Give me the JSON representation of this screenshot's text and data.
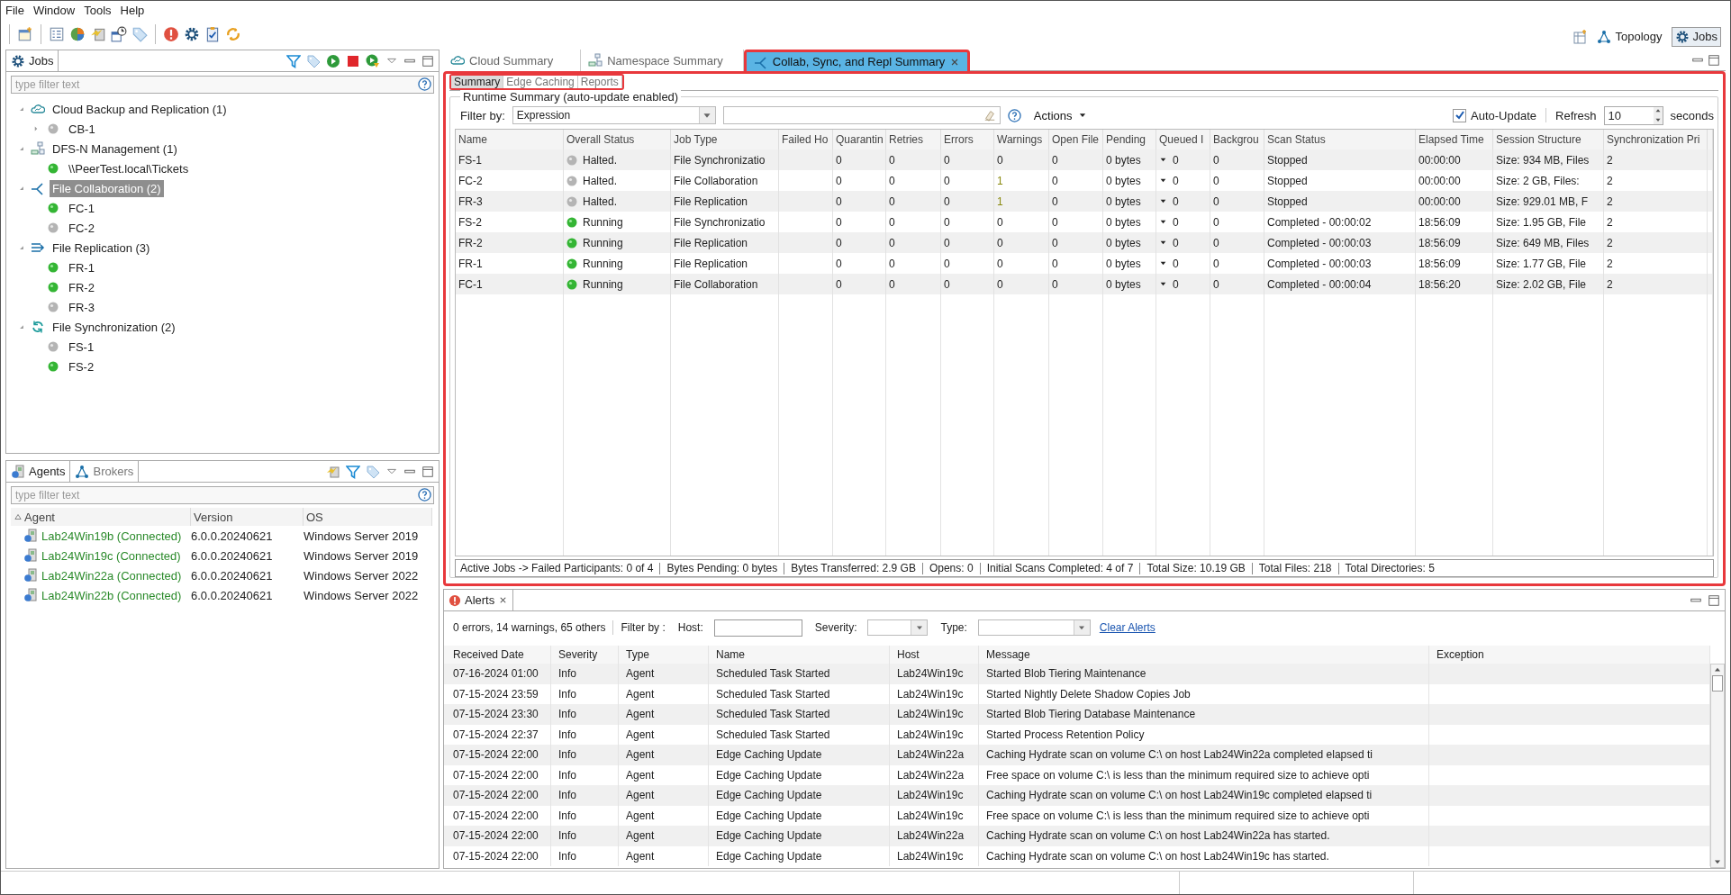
{
  "menu": [
    "File",
    "Window",
    "Tools",
    "Help"
  ],
  "perspectives": [
    {
      "label": "Topology",
      "selected": false
    },
    {
      "label": "Jobs",
      "selected": true
    }
  ],
  "jobs_panel": {
    "title": "Jobs",
    "filter_placeholder": "type filter text",
    "tree": [
      {
        "label": "Cloud Backup and Replication (1)",
        "kind": "cloud",
        "selected": false,
        "expanded": true,
        "children": [
          {
            "label": "CB-1",
            "running": false,
            "expandable": true
          }
        ]
      },
      {
        "label": "DFS-N Management (1)",
        "kind": "namespace",
        "selected": false,
        "expanded": true,
        "children": [
          {
            "label": "\\\\PeerTest.local\\Tickets",
            "running": true,
            "expandable": false
          }
        ]
      },
      {
        "label": "File Collaboration (2)",
        "kind": "collab",
        "selected": true,
        "expanded": true,
        "children": [
          {
            "label": "FC-1",
            "running": true,
            "expandable": false
          },
          {
            "label": "FC-2",
            "running": false,
            "expandable": false
          }
        ]
      },
      {
        "label": "File Replication (3)",
        "kind": "replication",
        "selected": false,
        "expanded": true,
        "children": [
          {
            "label": "FR-1",
            "running": true,
            "expandable": false
          },
          {
            "label": "FR-2",
            "running": true,
            "expandable": false
          },
          {
            "label": "FR-3",
            "running": false,
            "expandable": false
          }
        ]
      },
      {
        "label": "File Synchronization (2)",
        "kind": "sync",
        "selected": false,
        "expanded": true,
        "children": [
          {
            "label": "FS-1",
            "running": false,
            "expandable": false
          },
          {
            "label": "FS-2",
            "running": true,
            "expandable": false
          }
        ]
      }
    ]
  },
  "agents_panel": {
    "tabs": [
      {
        "label": "Agents",
        "kind": "agents",
        "selected": true
      },
      {
        "label": "Brokers",
        "kind": "brokers",
        "selected": false
      }
    ],
    "filter_placeholder": "type filter text",
    "columns": [
      "Agent",
      "Version",
      "OS"
    ],
    "rows": [
      {
        "agent": "Lab24Win19b (Connected)",
        "version": "6.0.0.20240621",
        "os": "Windows Server 2019",
        "connected": true
      },
      {
        "agent": "Lab24Win19c (Connected)",
        "version": "6.0.0.20240621",
        "os": "Windows Server 2019",
        "connected": true
      },
      {
        "agent": "Lab24Win22a (Connected)",
        "version": "6.0.0.20240621",
        "os": "Windows Server 2022",
        "connected": true
      },
      {
        "agent": "Lab24Win22b (Connected)",
        "version": "6.0.0.20240621",
        "os": "Windows Server 2022",
        "connected": true
      }
    ]
  },
  "editor_tabs": [
    {
      "label": "Cloud Summary",
      "kind": "cloud",
      "selected": false,
      "closable": false
    },
    {
      "label": "Namespace Summary",
      "kind": "namespace",
      "selected": false,
      "closable": false
    },
    {
      "label": "Collab, Sync, and Repl Summary",
      "kind": "collab",
      "selected": true,
      "closable": true
    }
  ],
  "sub_tabs": [
    {
      "label": "Summary",
      "selected": true
    },
    {
      "label": "Edge Caching",
      "selected": false
    },
    {
      "label": "Reports",
      "selected": false
    }
  ],
  "runtime": {
    "group_title": "Runtime Summary (auto-update enabled)",
    "filter_label": "Filter by:",
    "filter_value": "Expression",
    "actions": "Actions",
    "auto_update": {
      "label": "Auto-Update",
      "checked": true
    },
    "refresh_label": "Refresh",
    "refresh_value": "10",
    "refresh_unit": "seconds"
  },
  "jobs_table": {
    "columns": [
      {
        "label": "Name",
        "kind": "text"
      },
      {
        "label": "Overall Status",
        "kind": "status"
      },
      {
        "label": "Job Type",
        "kind": "text"
      },
      {
        "label": "Failed Ho",
        "kind": "text"
      },
      {
        "label": "Quarantin",
        "kind": "text"
      },
      {
        "label": "Retries",
        "kind": "text"
      },
      {
        "label": "Errors",
        "kind": "text"
      },
      {
        "label": "Warnings",
        "kind": "warnings"
      },
      {
        "label": "Open File",
        "kind": "text"
      },
      {
        "label": "Pending",
        "kind": "text"
      },
      {
        "label": "Queued I",
        "kind": "queued"
      },
      {
        "label": "Backgrou",
        "kind": "text"
      },
      {
        "label": "Scan Status",
        "kind": "text"
      },
      {
        "label": "Elapsed Time",
        "kind": "text"
      },
      {
        "label": "Session Structure",
        "kind": "text"
      },
      {
        "label": "Synchronization Pri",
        "kind": "text"
      }
    ],
    "rows": [
      {
        "running": false,
        "warned": false,
        "cells": [
          "FS-1",
          "Halted.",
          "File Synchronizatio",
          null,
          "0",
          "0",
          "0",
          "0",
          "0",
          "0 bytes",
          "0",
          "0",
          "Stopped",
          "00:00:00",
          "Size: 934 MB, Files",
          "2"
        ]
      },
      {
        "running": false,
        "warned": true,
        "cells": [
          "FC-2",
          "Halted.",
          "File Collaboration",
          null,
          "0",
          "0",
          "0",
          "1",
          "0",
          "0 bytes",
          "0",
          "0",
          "Stopped",
          "00:00:00",
          "Size: 2 GB, Files:",
          "2"
        ]
      },
      {
        "running": false,
        "warned": true,
        "cells": [
          "FR-3",
          "Halted.",
          "File Replication",
          null,
          "0",
          "0",
          "0",
          "1",
          "0",
          "0 bytes",
          "0",
          "0",
          "Stopped",
          "00:00:00",
          "Size: 929.01 MB, F",
          "2"
        ]
      },
      {
        "running": true,
        "warned": false,
        "cells": [
          "FS-2",
          "Running",
          "File Synchronizatio",
          null,
          "0",
          "0",
          "0",
          "0",
          "0",
          "0 bytes",
          "0",
          "0",
          "Completed - 00:00:02",
          "18:56:09",
          "Size: 1.95 GB, File",
          "2"
        ]
      },
      {
        "running": true,
        "warned": false,
        "cells": [
          "FR-2",
          "Running",
          "File Replication",
          null,
          "0",
          "0",
          "0",
          "0",
          "0",
          "0 bytes",
          "0",
          "0",
          "Completed - 00:00:03",
          "18:56:09",
          "Size: 649 MB, Files",
          "2"
        ]
      },
      {
        "running": true,
        "warned": false,
        "cells": [
          "FR-1",
          "Running",
          "File Replication",
          null,
          "0",
          "0",
          "0",
          "0",
          "0",
          "0 bytes",
          "0",
          "0",
          "Completed - 00:00:03",
          "18:56:09",
          "Size: 1.77 GB, File",
          "2"
        ]
      },
      {
        "running": true,
        "warned": false,
        "cells": [
          "FC-1",
          "Running",
          "File Collaboration",
          null,
          "0",
          "0",
          "0",
          "0",
          "0",
          "0 bytes",
          "0",
          "0",
          "Completed - 00:00:04",
          "18:56:20",
          "Size: 2.02 GB, File",
          "2"
        ]
      }
    ]
  },
  "summary_bar": [
    "Active Jobs -> Failed Participants: 0 of 4",
    "Bytes Pending: 0 bytes",
    "Bytes Transferred: 2.9 GB",
    "Opens: 0",
    "Initial Scans Completed: 4 of 7",
    "Total Size: 10.19 GB",
    "Total Files: 218",
    "Total Directories: 5"
  ],
  "alerts": {
    "title": "Alerts",
    "counts": "0 errors, 14 warnings, 65 others",
    "filter_label": "Filter by :",
    "host_label": "Host:",
    "severity_label": "Severity:",
    "type_label": "Type:",
    "clear": "Clear Alerts",
    "columns": [
      "Received Date",
      "Severity",
      "Type",
      "Name",
      "Host",
      "Message",
      "Exception"
    ],
    "rows": [
      [
        "07-16-2024 01:00",
        "Info",
        "Agent",
        "Scheduled Task Started",
        "Lab24Win19c",
        "Started Blob Tiering Maintenance"
      ],
      [
        "07-15-2024 23:59",
        "Info",
        "Agent",
        "Scheduled Task Started",
        "Lab24Win19c",
        "Started Nightly Delete Shadow Copies Job"
      ],
      [
        "07-15-2024 23:30",
        "Info",
        "Agent",
        "Scheduled Task Started",
        "Lab24Win19c",
        "Started Blob Tiering Database Maintenance"
      ],
      [
        "07-15-2024 22:37",
        "Info",
        "Agent",
        "Scheduled Task Started",
        "Lab24Win19c",
        "Started Process Retention Policy"
      ],
      [
        "07-15-2024 22:00",
        "Info",
        "Agent",
        "Edge Caching Update",
        "Lab24Win22a",
        "Caching Hydrate scan on volume C:\\ on host Lab24Win22a completed elapsed ti"
      ],
      [
        "07-15-2024 22:00",
        "Info",
        "Agent",
        "Edge Caching Update",
        "Lab24Win22a",
        "Free space on volume C:\\ is less than the minimum required size to achieve opti"
      ],
      [
        "07-15-2024 22:00",
        "Info",
        "Agent",
        "Edge Caching Update",
        "Lab24Win19c",
        "Caching Hydrate scan on volume C:\\ on host Lab24Win19c completed elapsed ti"
      ],
      [
        "07-15-2024 22:00",
        "Info",
        "Agent",
        "Edge Caching Update",
        "Lab24Win19c",
        "Free space on volume C:\\ is less than the minimum required size to achieve opti"
      ],
      [
        "07-15-2024 22:00",
        "Info",
        "Agent",
        "Edge Caching Update",
        "Lab24Win22a",
        "Caching Hydrate scan on volume C:\\ on host Lab24Win22a has started."
      ],
      [
        "07-15-2024 22:00",
        "Info",
        "Agent",
        "Edge Caching Update",
        "Lab24Win19c",
        "Caching Hydrate scan on volume C:\\ on host Lab24Win19c has started."
      ]
    ]
  }
}
